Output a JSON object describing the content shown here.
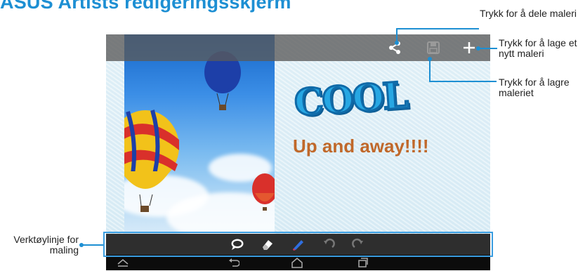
{
  "page_title": "ASUS Artists redigeringsskjerm",
  "canvas": {
    "heading_art": "COOL",
    "caption": "Up and away!!!!"
  },
  "action_bar": {
    "share_icon": "share-icon",
    "save_icon": "save-icon",
    "new_icon": "plus-icon"
  },
  "toolbar": {
    "items": [
      "speech-bubble-icon",
      "eraser-icon",
      "pen-icon",
      "undo-icon",
      "redo-icon"
    ]
  },
  "nav_bar": {
    "items": [
      "collapse-icon",
      "back-icon",
      "home-icon",
      "recent-apps-icon"
    ]
  },
  "callouts": {
    "share": "Trykk for å dele maleri",
    "new_painting": "Trykk for å lage et nytt maleri",
    "save": "Trykk for å lagre maleriet",
    "toolbar": "Verktøylinje for maling"
  },
  "colors": {
    "accent": "#1d8fd3",
    "caption": "#c0682a",
    "cool": "#27a7e3"
  }
}
